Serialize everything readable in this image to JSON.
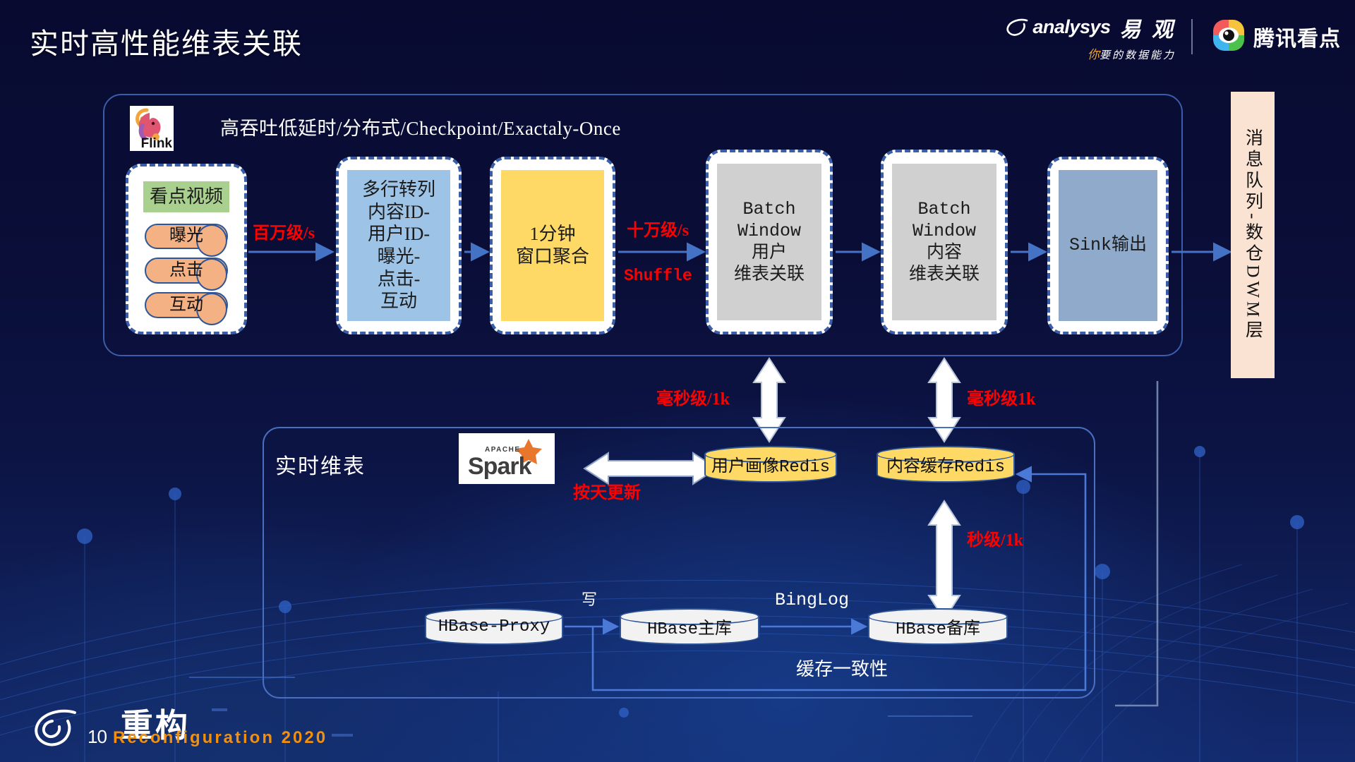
{
  "header": {
    "title": "实时高性能维表关联",
    "logos": {
      "analysys_word": "analysys",
      "analysys_cn": "易 观",
      "analysys_tag_accent": "你",
      "analysys_tag_rest": "要的数据能力",
      "kandian_text": "腾讯看点"
    }
  },
  "flink_section": {
    "logo_label": "Flink",
    "caption": "高吞吐低延时/分布式/Checkpoint/Exactaly-Once",
    "stages": [
      {
        "id": "source",
        "header": "看点视频",
        "chips": [
          "曝光",
          "点击",
          "互动"
        ],
        "fill": "#ffffff"
      },
      {
        "id": "transform",
        "lines": [
          "多行转列",
          "内容ID-",
          "用户ID-",
          "曝光-",
          "点击-",
          "互动"
        ],
        "fill": "#9dc3e6"
      },
      {
        "id": "window-agg",
        "lines": [
          "1分钟",
          "窗口聚合"
        ],
        "fill": "#ffd966"
      },
      {
        "id": "batch-window-user",
        "lines": [
          "Batch",
          "Window",
          "用户",
          "维表关联"
        ],
        "fill": "#d0d0d0"
      },
      {
        "id": "batch-window-content",
        "lines": [
          "Batch",
          "Window",
          "内容",
          "维表关联"
        ],
        "fill": "#d0d0d0"
      },
      {
        "id": "sink",
        "lines": [
          "Sink输出"
        ],
        "fill": "#8faaca"
      }
    ],
    "flow_labels": {
      "million_per_sec": "百万级/s",
      "hundred_thousand_per_sec": "十万级/s",
      "shuffle": "Shuffle"
    }
  },
  "message_queue": {
    "label": "消息队列-数仓DWM层"
  },
  "dim_section": {
    "title": "实时维表",
    "spark_apache": "APACHE",
    "spark_name": "Spark",
    "daily_update": "按天更新",
    "redis_user": "用户画像Redis",
    "redis_content": "内容缓存Redis",
    "latency_user": "毫秒级/1k",
    "latency_content": "毫秒级1k",
    "latency_hbase": "秒级/1k"
  },
  "hbase_section": {
    "proxy": "HBase-Proxy",
    "primary": "HBase主库",
    "standby": "HBase备库",
    "write_label": "写",
    "binlog_label": "BingLog",
    "consistency_label": "缓存一致性"
  },
  "brand": {
    "page_number": "10",
    "cn": "重构",
    "en": "Reconfiguration 2020"
  },
  "colors": {
    "bg_dark": "#080a30",
    "bg_blue": "#132a6e",
    "accent_red": "#ff0000",
    "accent_orange": "#f2900d",
    "box_border": "#3a5ea8",
    "arrow_blue": "#4472c4",
    "green": "#a9d08e",
    "orange_chip": "#f4b183",
    "light_blue": "#9dc3e6",
    "yellow": "#ffd966",
    "gray": "#d0d0d0",
    "steel": "#8faaca",
    "peach": "#fae3d2"
  }
}
